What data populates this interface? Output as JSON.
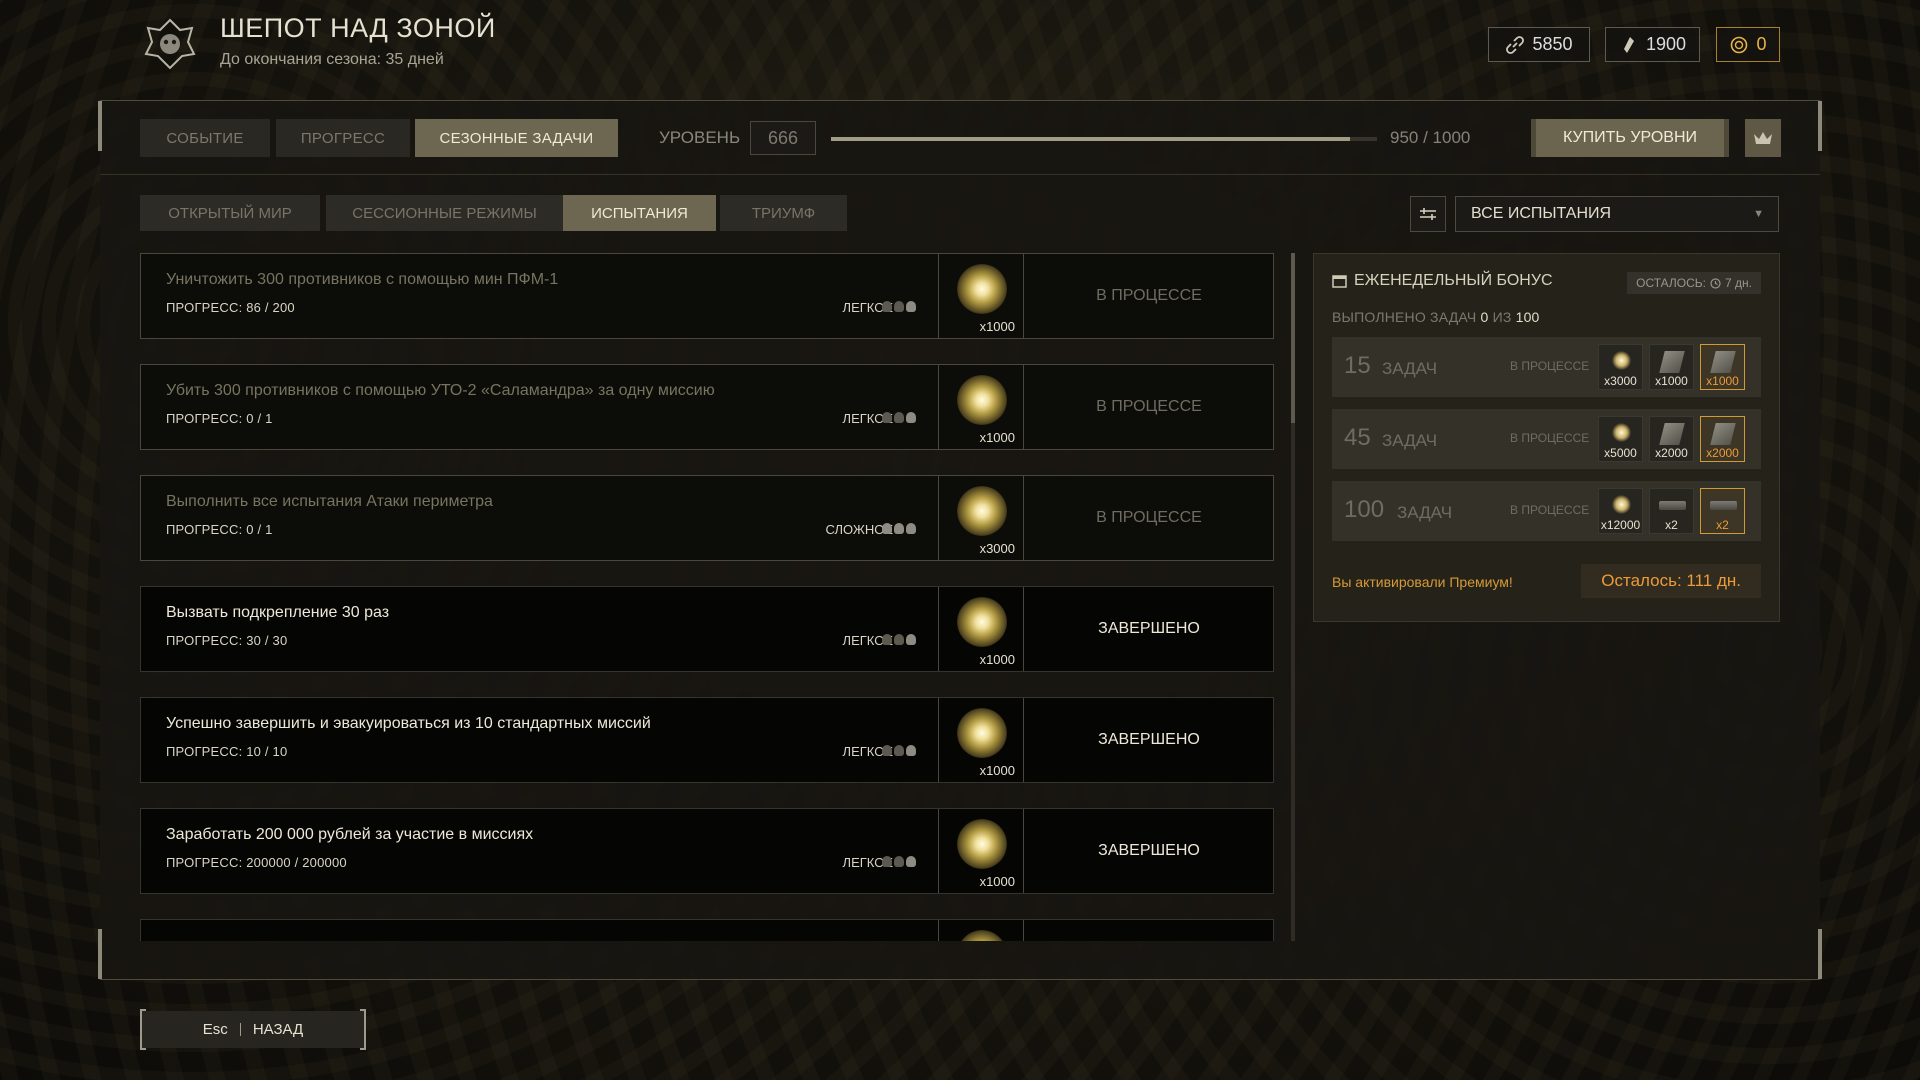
{
  "header": {
    "title": "ШЕПОТ НАД ЗОНОЙ",
    "subtitle": "До окончания сезона: 35 дней",
    "currencies": [
      {
        "icon": "chain-icon",
        "value": "5850"
      },
      {
        "icon": "crystal-icon",
        "value": "1900"
      },
      {
        "icon": "coin-icon",
        "value": "0",
        "color": "#e8b44a"
      }
    ]
  },
  "tabs": [
    "СОБЫТИЕ",
    "ПРОГРЕСС",
    "СЕЗОННЫЕ ЗАДАЧИ"
  ],
  "level": {
    "label": "УРОВЕНЬ",
    "value": "666",
    "progress_text": "950 / 1000",
    "progress": 0.95
  },
  "buy_levels": "КУПИТЬ УРОВНИ",
  "subtabs": [
    "ОТКРЫТЫЙ МИР",
    "СЕССИОННЫЕ РЕЖИМЫ",
    "ИСПЫТАНИЯ",
    "ТРИУМФ"
  ],
  "filter": {
    "selected": "ВСЕ ИСПЫТАНИЯ"
  },
  "tasks": [
    {
      "name": "Уничтожить 300 противников с помощью мин ПФМ-1",
      "progress": "ПРОГРЕСС: 86 / 200",
      "difficulty": "ЛЕГКОЕ",
      "reward": "x1000",
      "status": "В ПРОЦЕССЕ"
    },
    {
      "name": "Убить 300 противников с помощью УТО-2 «Саламандра» за одну миссию",
      "progress": "ПРОГРЕСС: 0 / 1",
      "difficulty": "ЛЕГКОЕ",
      "reward": "x1000",
      "status": "В ПРОЦЕССЕ"
    },
    {
      "name": "Выполнить все испытания Атаки периметра",
      "progress": "ПРОГРЕСС: 0 / 1",
      "difficulty": "СЛОЖНОЕ",
      "reward": "x3000",
      "status": "В ПРОЦЕССЕ"
    },
    {
      "name": "Вызвать подкрепление 30 раз",
      "progress": "ПРОГРЕСС: 30 / 30",
      "difficulty": "ЛЕГКОЕ",
      "reward": "x1000",
      "status": "ЗАВЕРШЕНО"
    },
    {
      "name": "Успешно завершить и эвакуироваться из 10 стандартных миссий",
      "progress": "ПРОГРЕСС: 10 / 10",
      "difficulty": "ЛЕГКОЕ",
      "reward": "x1000",
      "status": "ЗАВЕРШЕНО"
    },
    {
      "name": "Заработать 200 000 рублей за участие в миссиях",
      "progress": "ПРОГРЕСС: 200000 / 200000",
      "difficulty": "ЛЕГКОЕ",
      "reward": "x1000",
      "status": "ЗАВЕРШЕНО"
    }
  ],
  "bonus": {
    "title": "ЕЖЕНЕДЕЛЬНЫЙ БОНУС",
    "left": "ОСТАЛОСЬ:",
    "left_days": "7 дн.",
    "done_prefix": "ВЫПОЛНЕНО ЗАДАЧ",
    "done_count": "0",
    "done_of": "ИЗ",
    "done_total": "100",
    "tiers": [
      {
        "num": "15",
        "label": "ЗАДАЧ",
        "status": "В ПРОЦЕССЕ",
        "rewards": [
          "x3000",
          "x1000",
          "x1000"
        ]
      },
      {
        "num": "45",
        "label": "ЗАДАЧ",
        "status": "В ПРОЦЕССЕ",
        "rewards": [
          "x5000",
          "x2000",
          "x2000"
        ]
      },
      {
        "num": "100",
        "label": "ЗАДАЧ",
        "status": "В ПРОЦЕССЕ",
        "rewards": [
          "x12000",
          "x2",
          "x2"
        ]
      }
    ],
    "premium": "Вы активировали Премиум!",
    "premium_left": "Осталось: 111 дн."
  },
  "back": {
    "key": "Esc",
    "label": "НАЗАД"
  },
  "colors": {
    "accent": "#6d6650",
    "premium": "#ec9b38"
  }
}
